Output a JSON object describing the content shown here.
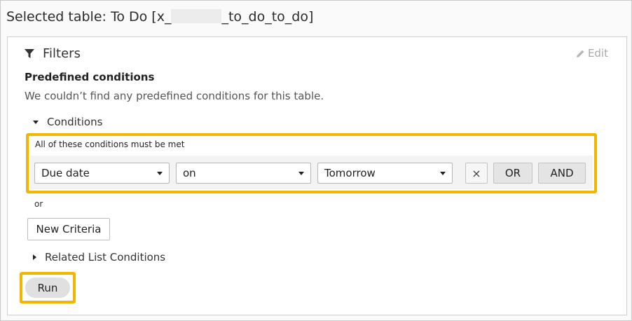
{
  "header": {
    "title_prefix": "Selected table: To Do [x_",
    "title_suffix": "_to_do_to_do]"
  },
  "filters": {
    "heading": "Filters",
    "edit_label": "Edit",
    "predefined_title": "Predefined conditions",
    "predefined_message": "We couldn’t find any predefined conditions for this table.",
    "conditions_toggle": "Conditions",
    "conditions_caption": "All of these conditions must be met",
    "condition": {
      "field": "Due date",
      "operator": "on",
      "value": "Tomorrow"
    },
    "remove_label": "×",
    "or_button": "OR",
    "and_button": "AND",
    "or_separator": "or",
    "new_criteria_button": "New Criteria",
    "related_toggle": "Related List Conditions",
    "run_button": "Run"
  },
  "colors": {
    "highlight": "#f2b600"
  },
  "icons": [
    "filter-icon",
    "pencil-icon",
    "caret-down-icon",
    "caret-right-icon",
    "close-icon"
  ]
}
